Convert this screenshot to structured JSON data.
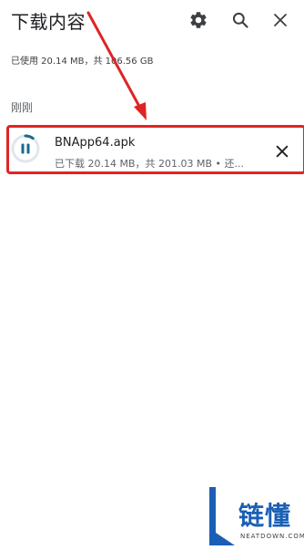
{
  "header": {
    "title": "下载内容",
    "settings_icon": "gear-icon",
    "search_icon": "search-icon",
    "close_icon": "close-icon"
  },
  "storage": {
    "text": "已使用 20.14 MB，共 106.56 GB"
  },
  "section": {
    "label": "刚刚"
  },
  "downloads": [
    {
      "filename": "BNApp64.apk",
      "status": "已下载 20.14 MB，共 201.03 MB • 还...",
      "progress": 0.1,
      "state_icon": "pause-icon",
      "remove_icon": "close-icon"
    }
  ],
  "annotation": {
    "color": "#e02424"
  },
  "watermark": {
    "cn": "链懂",
    "en": "NEATDOWN.COM"
  },
  "colors": {
    "accent": "#1a73e8",
    "progress_track": "#dfe7ec",
    "progress_fill": "#1a6a8c"
  }
}
